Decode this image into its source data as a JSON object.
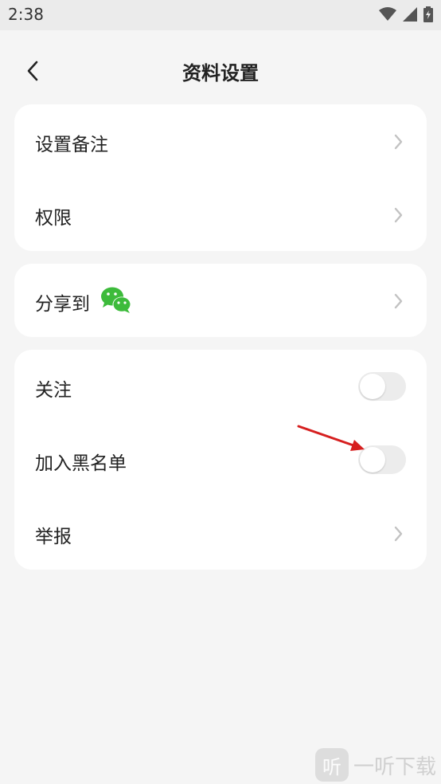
{
  "status_bar": {
    "time": "2:38"
  },
  "header": {
    "title": "资料设置"
  },
  "group1": {
    "items": [
      {
        "label": "设置备注"
      },
      {
        "label": "权限"
      }
    ]
  },
  "group2": {
    "items": [
      {
        "label": "分享到",
        "icon": "wechat-icon",
        "icon_color": "#3dbb3b"
      }
    ]
  },
  "group3": {
    "items": [
      {
        "label": "关注",
        "toggle_on": false
      },
      {
        "label": "加入黑名单",
        "toggle_on": false
      },
      {
        "label": "举报"
      }
    ]
  },
  "annotation": {
    "arrow_color": "#d61f1f"
  },
  "watermark": {
    "logo_glyph": "听",
    "text": "一听下载"
  }
}
